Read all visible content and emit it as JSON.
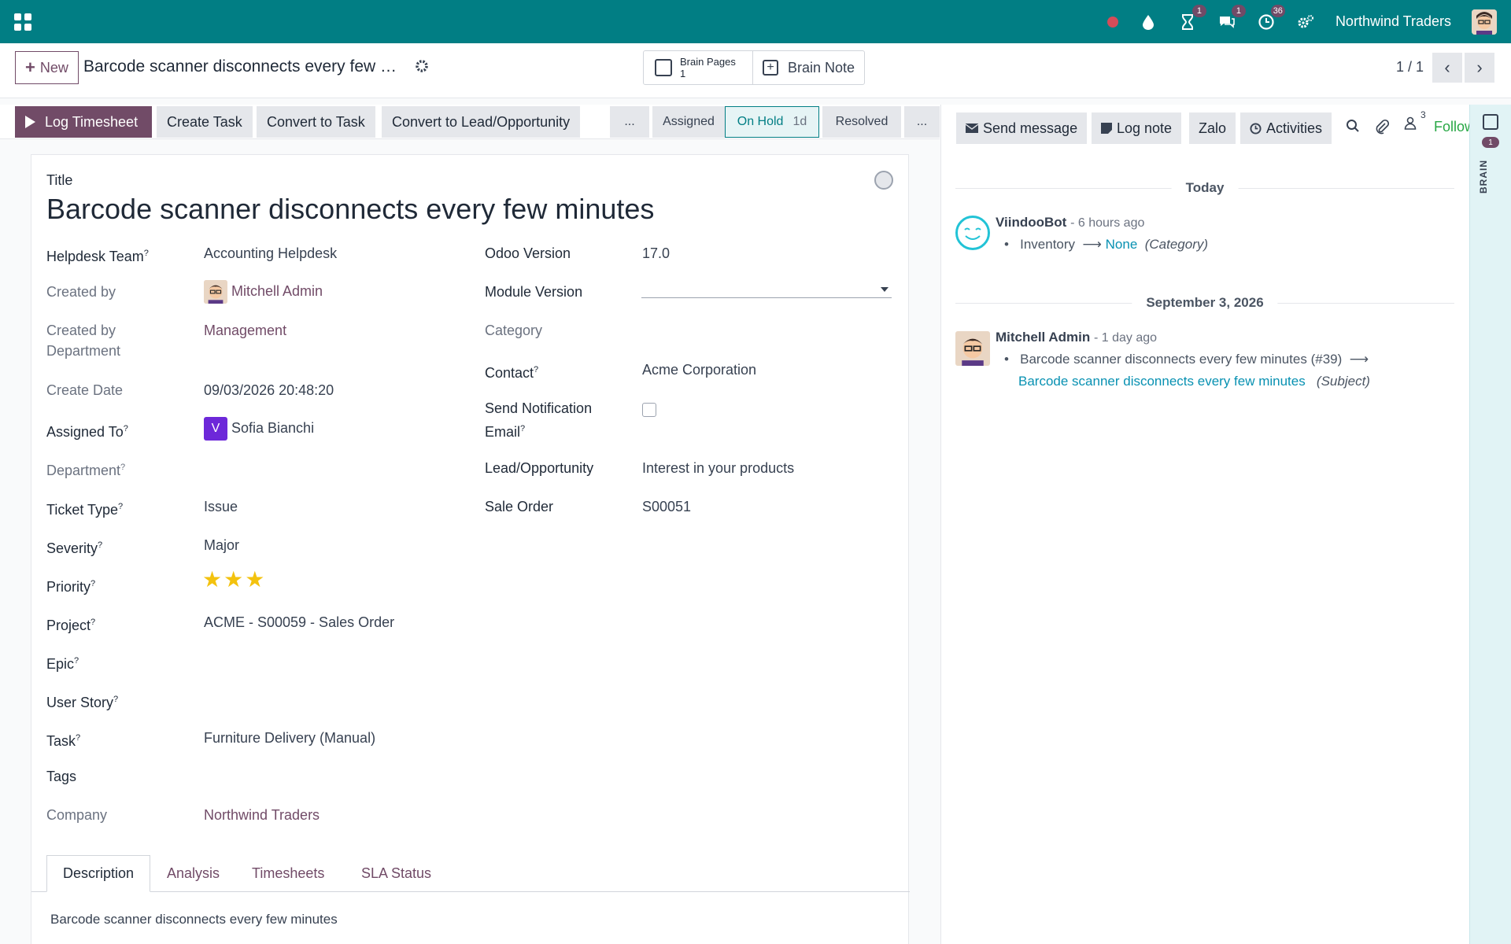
{
  "topbar": {
    "company": "Northwind Traders",
    "badges": {
      "activity": "1",
      "messages": "1",
      "timer": "36"
    }
  },
  "control": {
    "new_label": "New",
    "record_title": "Barcode scanner disconnects every few minutes",
    "brain_pages_label": "Brain Pages",
    "brain_pages_count": "1",
    "brain_note_label": "Brain Note",
    "pager": "1 / 1"
  },
  "header": {
    "buttons": [
      "Log Timesheet",
      "Create Task",
      "Convert to Task",
      "Convert to Lead/Opportunity"
    ],
    "stages": [
      {
        "label": "...",
        "duration": ""
      },
      {
        "label": "Assigned",
        "duration": ""
      },
      {
        "label": "On Hold",
        "duration": "1d"
      },
      {
        "label": "Resolved",
        "duration": ""
      },
      {
        "label": "...",
        "duration": ""
      }
    ]
  },
  "form": {
    "title_label": "Title",
    "title": "Barcode scanner disconnects every few minutes",
    "left": [
      {
        "label": "Helpdesk Team",
        "help": "?",
        "value": "Accounting Helpdesk"
      },
      {
        "label": "Created by",
        "help": "",
        "value": "Mitchell Admin"
      },
      {
        "label": "Created by Department",
        "help": "",
        "value": "Management"
      },
      {
        "label": "Create Date",
        "help": "",
        "value": "09/03/2026 20:48:20"
      },
      {
        "label": "Assigned To",
        "help": "?",
        "value": "Sofia Bianchi",
        "initial": "V"
      },
      {
        "label": "Department",
        "help": "?",
        "value": ""
      },
      {
        "label": "Ticket Type",
        "help": "?",
        "value": "Issue"
      },
      {
        "label": "Severity",
        "help": "?",
        "value": "Major"
      },
      {
        "label": "Priority",
        "help": "?",
        "value": "",
        "stars": 3
      },
      {
        "label": "Project",
        "help": "?",
        "value": "ACME - S00059 - Sales Order"
      },
      {
        "label": "Epic",
        "help": "?",
        "value": ""
      },
      {
        "label": "User Story",
        "help": "?",
        "value": ""
      },
      {
        "label": "Task",
        "help": "?",
        "value": "Furniture Delivery (Manual)"
      },
      {
        "label": "Tags",
        "help": "",
        "value": ""
      },
      {
        "label": "Company",
        "help": "",
        "value": "Northwind Traders"
      }
    ],
    "right": [
      {
        "label": "Odoo Version",
        "help": "",
        "value": "17.0"
      },
      {
        "label": "Module Version",
        "help": "",
        "value": ""
      },
      {
        "label": "Category",
        "help": "",
        "value": ""
      },
      {
        "label": "Contact",
        "help": "?",
        "value": "Acme Corporation"
      },
      {
        "label": "Send Notification Email",
        "help": "?",
        "value": "",
        "checked": false
      },
      {
        "label": "Lead/Opportunity",
        "help": "",
        "value": "Interest in your products"
      },
      {
        "label": "Sale Order",
        "help": "",
        "value": "S00051"
      }
    ],
    "tabs": [
      "Description",
      "Analysis",
      "Timesheets",
      "SLA Status"
    ],
    "description": "Barcode scanner disconnects every few minutes"
  },
  "chatter": {
    "buttons": [
      "Send message",
      "Log note",
      "Zalo",
      "Activities"
    ],
    "followers_count": "3",
    "follow_label": "Follow",
    "groups": [
      {
        "date": "Today",
        "author": "ViindooBot",
        "time": "- 6 hours ago",
        "old_value": "Inventory",
        "new_value": "None",
        "field": "(Category)"
      },
      {
        "date": "September 3, 2026",
        "author": "Mitchell Admin",
        "time": "- 1 day ago",
        "old_value": "Barcode scanner disconnects every few minutes (#39)",
        "new_value": "Barcode scanner disconnects every few minutes",
        "field": "(Subject)"
      }
    ]
  },
  "brain_strip": {
    "count": "1",
    "label": "BRAIN"
  },
  "colors": {
    "primary": "#714b67",
    "topbar": "#017e84",
    "link": "#0891b2",
    "follow": "#28a745",
    "star": "#f3c20e"
  }
}
